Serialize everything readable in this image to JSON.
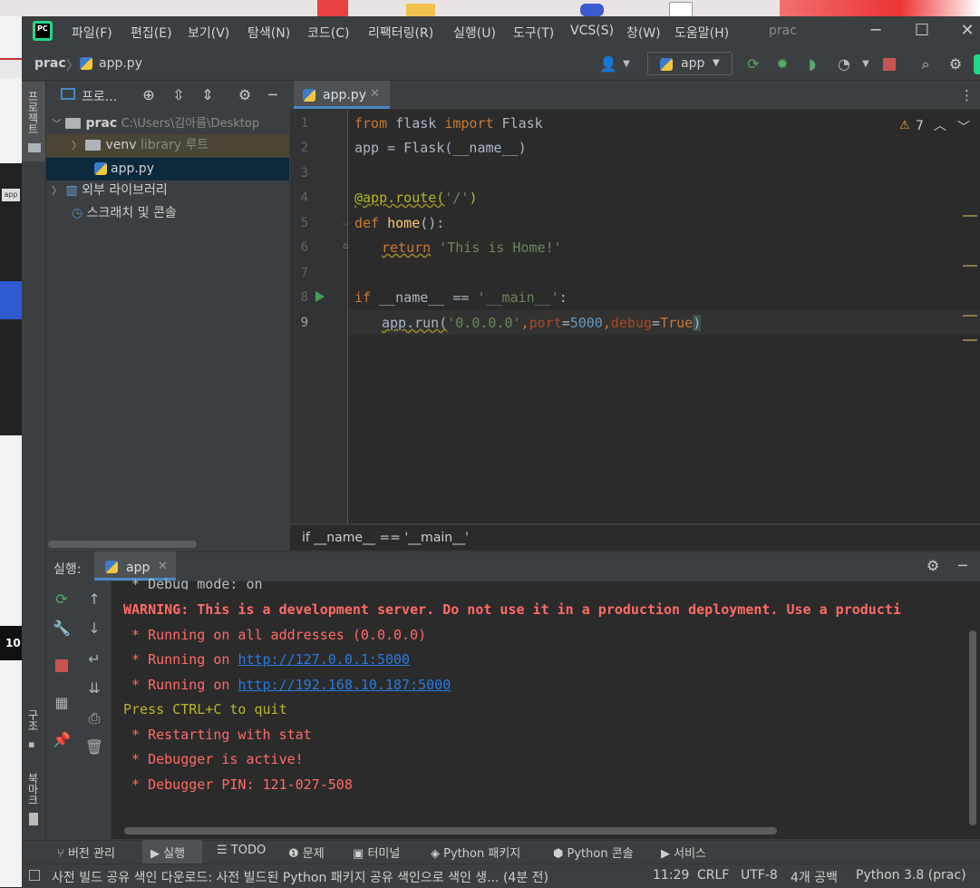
{
  "colors": {
    "accent": "#4a88c7",
    "ide_bg": "#2b2b2b",
    "panel_bg": "#3c3f41",
    "error_red": "#ff6b68",
    "link_blue": "#287bde"
  },
  "menu": [
    "파일(F)",
    "편집(E)",
    "보기(V)",
    "탐색(N)",
    "코드(C)",
    "리팩터링(R)",
    "실행(U)",
    "도구(T)",
    "VCS(S)",
    "창(W)",
    "도움말(H)"
  ],
  "window_title": "prac",
  "nav": {
    "project": "prac",
    "file": "app.py",
    "run_config": "app"
  },
  "toolbar_icons": [
    "user-icon",
    "rerun-icon",
    "debug-icon",
    "coverage-icon",
    "profile-icon",
    "stop-icon",
    "search-icon",
    "settings-icon"
  ],
  "left_strip": {
    "project_label": "프로젝트",
    "structure_label": "구조",
    "bookmarks_label": "북마크"
  },
  "desktop": {
    "snippet_app": "app",
    "snippet_10": "10"
  },
  "project_panel": {
    "title": "프로...",
    "tree": [
      {
        "name": "prac",
        "path": "C:\\Users\\김아름\\Desktop"
      },
      {
        "name": "venv",
        "note": "library 루트"
      },
      {
        "name": "app.py"
      },
      {
        "name": "외부 라이브러리"
      },
      {
        "name": "스크래치 및 콘솔"
      }
    ]
  },
  "editor": {
    "tab": "app.py",
    "warnings": "7",
    "lines": [
      "1",
      "2",
      "3",
      "4",
      "5",
      "6",
      "7",
      "8",
      "9"
    ],
    "code": {
      "l1_from": "from",
      "l1_mod": " flask ",
      "l1_import": "import",
      "l1_cls": " Flask",
      "l2": "app = Flask(__name__)",
      "l4": "@app.route(",
      "l4_str": "'/'",
      "l4_end": ")",
      "l5_def": "def",
      "l5_fn": " home",
      "l5_end": "():",
      "l6_ret": "return",
      "l6_str": " 'This is Home!'",
      "l8_if": "if",
      "l8_mid": " __name__ == ",
      "l8_str": "'__main__'",
      "l8_end": ":",
      "l9_a": "app.run(",
      "l9_host": "'0.0.0.0'",
      "l9_comma1": ",",
      "l9_port": "port",
      "l9_eq": "=",
      "l9_num": "5000",
      "l9_comma2": ",",
      "l9_debug": "debug",
      "l9_eq2": "=",
      "l9_true": "True",
      "l9_end": ")"
    },
    "breadcrumb": "if __name__ == '__main__'"
  },
  "run_panel": {
    "label": "실행:",
    "tab": "app",
    "console": {
      "debug_mode": " * Debug mode: on",
      "warning": "WARNING: This is a development server. Do not use it in a production deployment. Use a producti",
      "running_all": " * Running on all addresses (0.0.0.0)",
      "running_on_prefix1": " * Running on ",
      "url1": "http://127.0.0.1:5000",
      "running_on_prefix2": " * Running on ",
      "url2": "http://192.168.10.187:5000",
      "quit": "Press CTRL+C to quit",
      "restarting": " * Restarting with stat",
      "debugger_active": " * Debugger is active!",
      "debugger_pin": " * Debugger PIN: 121-027-508"
    }
  },
  "bottom_tabs": [
    "버전 관리",
    "실행",
    "TODO",
    "문제",
    "터미널",
    "Python 패키지",
    "Python 콘솔",
    "서비스"
  ],
  "status": {
    "message": "사전 빌드 공유 색인 다운로드: 사전 빌드된 Python 패키지 공유 색인으로 색인 생... (4분 전)",
    "position": "11:29",
    "line_sep": "CRLF",
    "encoding": "UTF-8",
    "indent": "4개 공백",
    "interpreter": "Python 3.8 (prac)"
  }
}
